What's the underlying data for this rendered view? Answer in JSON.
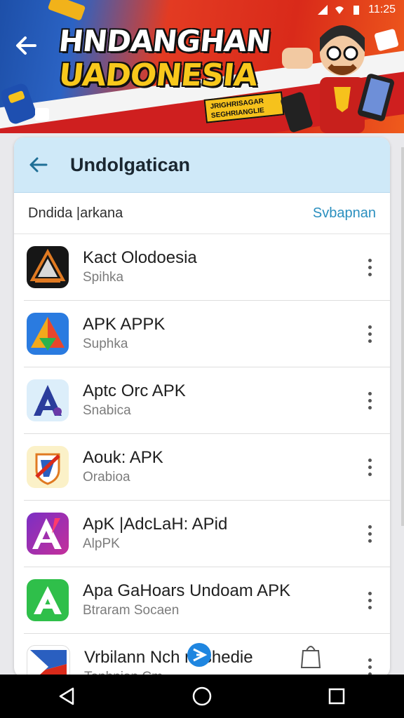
{
  "status_bar": {
    "time": "11:25"
  },
  "banner": {
    "title": "HNDANGHAN",
    "subtitle": "UADONESIA",
    "tag": "JRIGHRISAGAR SEGHRIANGLIE"
  },
  "header": {
    "title": "Undolgatican"
  },
  "section": {
    "label": "Dndida |arkana",
    "link": "Svbapnan"
  },
  "apps": [
    {
      "name": "Kact Olodoesia",
      "sub": "Spihka"
    },
    {
      "name": "APK APPK",
      "sub": "Suphka"
    },
    {
      "name": "Aptc Orc APK",
      "sub": "Snabica"
    },
    {
      "name": "Aouk: APK",
      "sub": "Orabioa"
    },
    {
      "name": "ApK |AdcLaH: APid",
      "sub": "AlpPK"
    },
    {
      "name": "Apa GaHoars Undoam APK",
      "sub": "Btraram Socaen"
    },
    {
      "name": "Vrbilann Nch noshedie",
      "sub": "Tonhnian Cm"
    }
  ],
  "colors": {
    "header_bg": "#cfe9f8",
    "accent": "#2a8fbf",
    "banner_red": "#d92a1a",
    "banner_yellow": "#f8c81c",
    "nav_bg": "#000000"
  },
  "icons": {
    "back": "arrow-left-icon",
    "more": "more-vertical-icon",
    "nav": [
      "back-triangle-icon",
      "home-circle-icon",
      "recents-square-icon"
    ]
  }
}
